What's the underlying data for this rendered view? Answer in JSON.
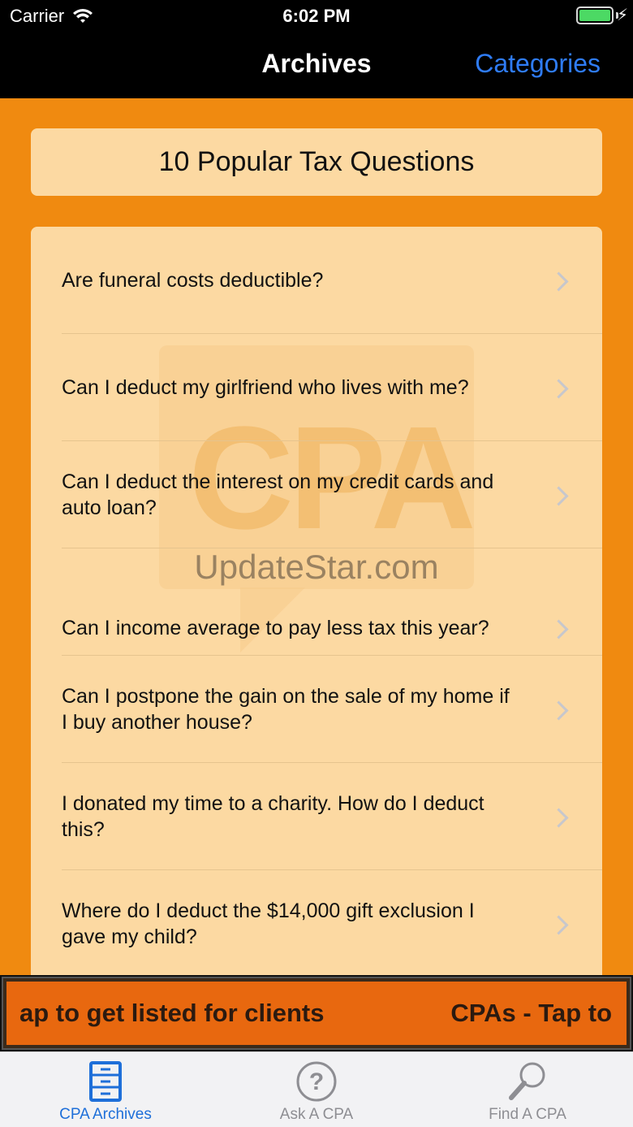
{
  "status_bar": {
    "carrier": "Carrier",
    "time": "6:02 PM"
  },
  "nav": {
    "title": "Archives",
    "right_button": "Categories"
  },
  "header": {
    "title": "10 Popular Tax Questions"
  },
  "watermark": {
    "logo_text": "CPA",
    "site": "UpdateStar.com"
  },
  "questions": [
    "Are funeral costs deductible?",
    "Can I deduct my girlfriend who lives with me?",
    "Can I deduct the interest on my credit cards and auto loan?",
    "Can I income average to pay less tax this year?",
    "Can I postpone the gain on the sale of my home if I buy another house?",
    "I donated my time to a charity. How do I deduct this?",
    "Where do I deduct the $14,000 gift exclusion I gave my child?"
  ],
  "banner": {
    "left_text": "ap to get listed for clients",
    "right_text": "CPAs - Tap to"
  },
  "tabs": [
    {
      "label": "CPA Archives",
      "icon": "archive-cabinet-icon",
      "active": true
    },
    {
      "label": "Ask A CPA",
      "icon": "question-circle-icon",
      "active": false
    },
    {
      "label": "Find A CPA",
      "icon": "magnifier-icon",
      "active": false
    }
  ],
  "colors": {
    "accent": "#1e6fd9",
    "background": "#f08a10",
    "card": "#fcd9a2",
    "nav_link": "#2f7cf6"
  }
}
